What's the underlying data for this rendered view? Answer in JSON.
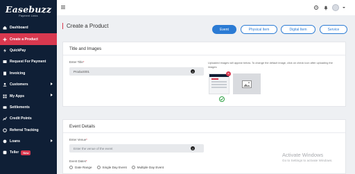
{
  "brand": {
    "logo": "Easebuzz",
    "tagline": "Payment Links"
  },
  "sidebar": {
    "items": [
      {
        "label": "Dashboard",
        "icon": "home-icon",
        "arrow": false,
        "active": false
      },
      {
        "label": "Create a Product",
        "icon": "plus-icon",
        "arrow": false,
        "active": true
      },
      {
        "label": "QuickPay",
        "icon": "bolt-icon",
        "arrow": false,
        "active": false
      },
      {
        "label": "Request For Payment",
        "icon": "request-icon",
        "arrow": false,
        "active": false
      },
      {
        "label": "Invoicing",
        "icon": "invoice-icon",
        "arrow": false,
        "active": false
      },
      {
        "label": "Customers",
        "icon": "customers-icon",
        "arrow": true,
        "active": false
      },
      {
        "label": "My Apps",
        "icon": "apps-icon",
        "arrow": true,
        "active": false
      },
      {
        "label": "Settlements",
        "icon": "settlements-icon",
        "arrow": false,
        "active": false
      },
      {
        "label": "Credit Points",
        "icon": "credit-points-icon",
        "arrow": false,
        "active": false
      },
      {
        "label": "Referral Tracking",
        "icon": "referral-icon",
        "arrow": false,
        "active": false
      },
      {
        "label": "Loans",
        "icon": "loans-icon",
        "arrow": true,
        "active": false
      },
      {
        "label": "Teller",
        "icon": "teller-icon",
        "arrow": false,
        "active": false,
        "badge": "New"
      }
    ]
  },
  "page": {
    "title": "Create a Product"
  },
  "tabs": [
    {
      "label": "Event",
      "selected": true
    },
    {
      "label": "Physical Item",
      "selected": false
    },
    {
      "label": "Digital Item",
      "selected": false
    },
    {
      "label": "Service",
      "selected": false
    }
  ],
  "title_images": {
    "heading": "Title and Images",
    "title_label": "Enter Title",
    "title_value": "Product001",
    "upload_note": "Uploaded images will appear below. To change the default image, click on check icon after uploading the images"
  },
  "event_details": {
    "heading": "Event Details",
    "venue_label": "Enter Venue",
    "venue_placeholder": "Enter the venue of the event",
    "dates_label": "Event Dates",
    "date_options": [
      "Date Range",
      "Single Day Event",
      "Multiple Day Event"
    ]
  },
  "watermark": {
    "line1": "Activate Windows",
    "line2": "Go to Settings to activate Windows."
  },
  "colors": {
    "sidebar_bg": "#0f1f36",
    "accent_red": "#d8384f",
    "accent_blue": "#2b7bd4"
  }
}
